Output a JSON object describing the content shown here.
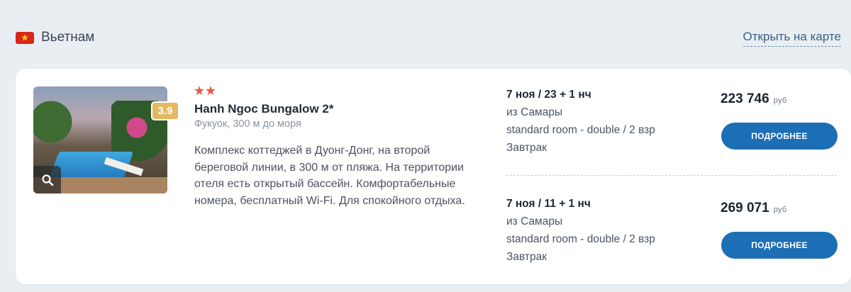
{
  "country": {
    "name": "Вьетнам",
    "map_link": "Открыть на карте"
  },
  "hotel": {
    "stars": 2,
    "name": "Hanh Ngoc Bungalow 2*",
    "rating": "3.9",
    "location": "Фукуок, 300 м до моря",
    "description": "Комплекс коттеджей в Дуонг-Донг, на второй береговой линии, в 300 м от пляжа. На территории отеля есть открытый бассейн. Комфортабельные номера, бесплатный Wi-Fi. Для спокойного отдыха."
  },
  "offers": [
    {
      "dates": "7 ноя / 23 + 1 нч",
      "departure": "из Самары",
      "room": "standard room - double / 2 взр",
      "meal": "Завтрак",
      "price": "223 746",
      "currency": "руб",
      "button": "ПОДРОБНЕЕ"
    },
    {
      "dates": "7 ноя / 11 + 1 нч",
      "departure": "из Самары",
      "room": "standard room - double / 2 взр",
      "meal": "Завтрак",
      "price": "269 071",
      "currency": "руб",
      "button": "ПОДРОБНЕЕ"
    }
  ],
  "colors": {
    "accent": "#1d6fb5",
    "rating_badge": "#e4b862",
    "star": "#e8584a",
    "flag_red": "#da251d",
    "flag_star": "#ffde00"
  },
  "icons": {
    "flag": "vietnam-flag-icon",
    "zoom": "magnifier-icon",
    "star": "star-icon"
  }
}
